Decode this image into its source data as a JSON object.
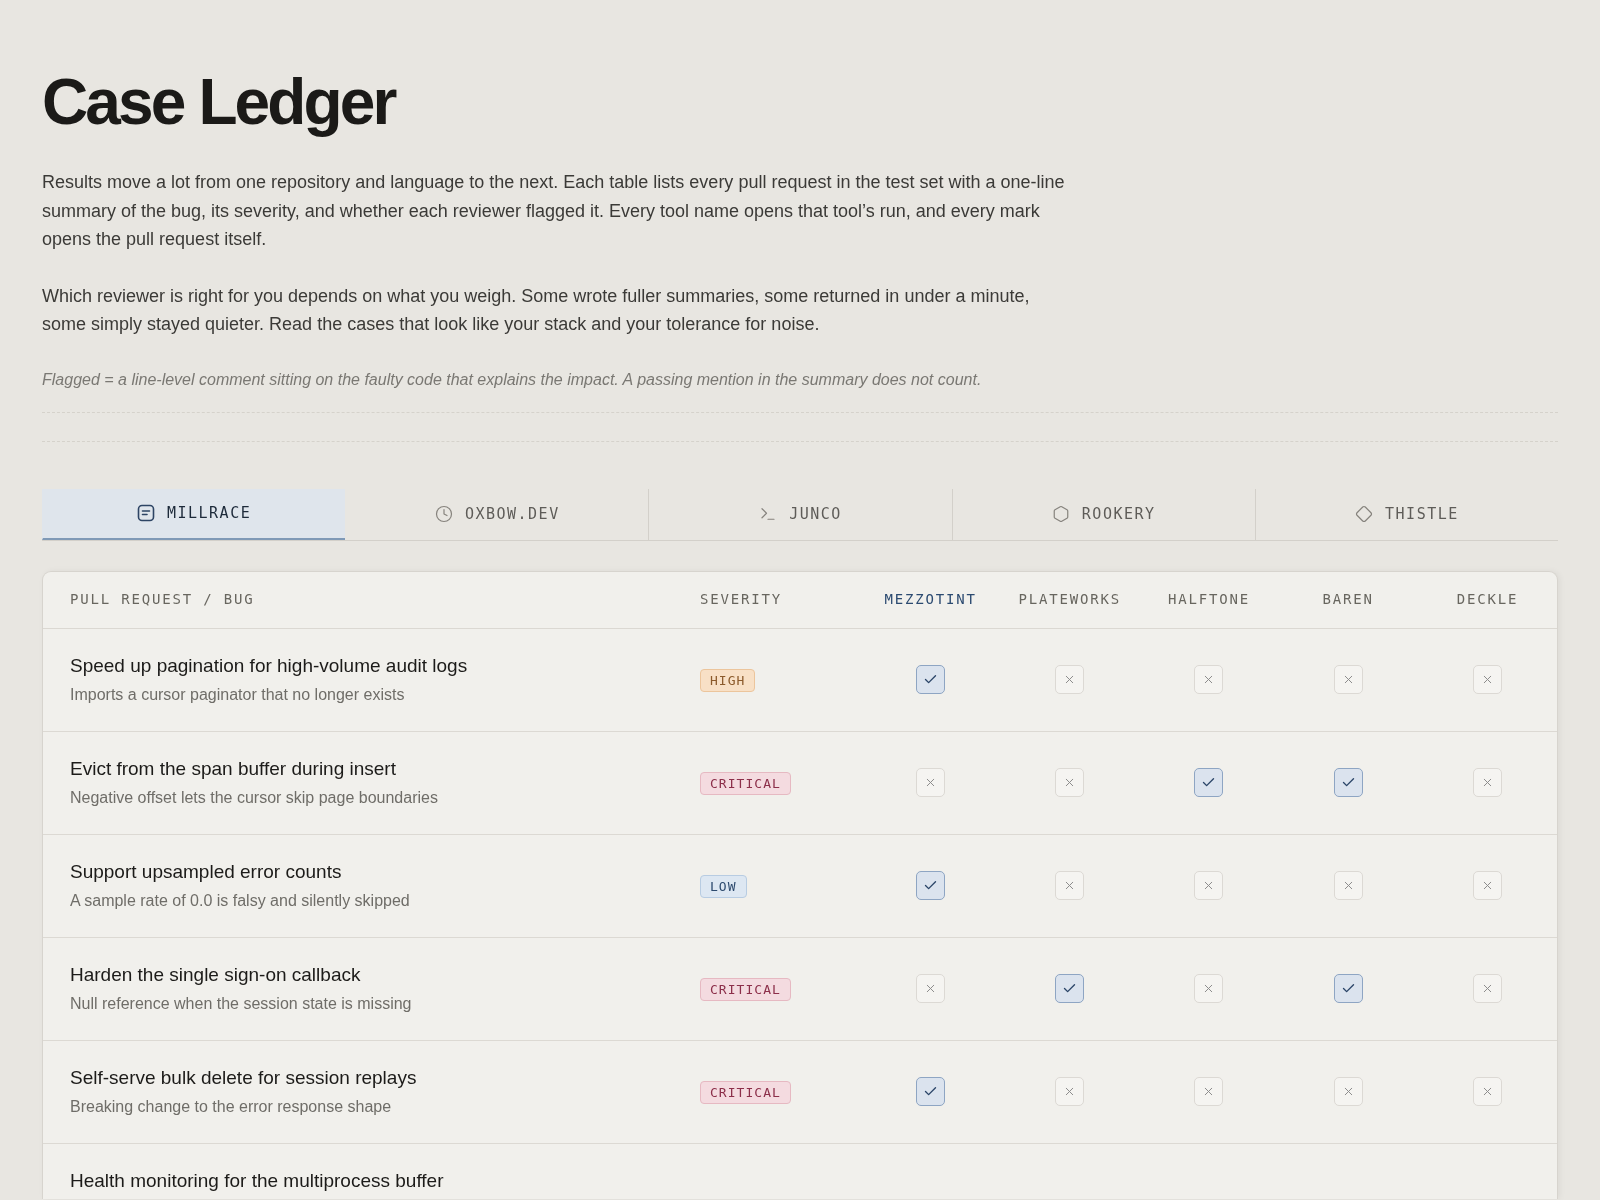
{
  "page": {
    "title": "Case Ledger",
    "paragraphs": [
      "Results move a lot from one repository and language to the next. Each table lists every pull request in the test set with a one-line summary of the bug, its severity, and whether each reviewer flagged it. Every tool name opens that tool’s run, and every mark opens the pull request itself.",
      "Which reviewer is right for you depends on what you weigh. Some wrote fuller summaries, some returned in under a minute, some simply stayed quieter. Read the cases that look like your stack and your tolerance for noise."
    ],
    "note": "Flagged = a line-level comment sitting on the faulty code that explains the impact. A passing mention in the summary does not count."
  },
  "tabs": [
    {
      "label": "MILLRACE",
      "selected": true
    },
    {
      "label": "OXBOW.DEV",
      "selected": false
    },
    {
      "label": "JUNCO",
      "selected": false
    },
    {
      "label": "ROOKERY",
      "selected": false
    },
    {
      "label": "THISTLE",
      "selected": false
    }
  ],
  "table": {
    "columns": [
      "PULL REQUEST / BUG",
      "SEVERITY"
    ],
    "tools": [
      {
        "label": "MEZZOTINT",
        "highlighted": true
      },
      {
        "label": "PLATEWORKS",
        "highlighted": false
      },
      {
        "label": "HALFTONE",
        "highlighted": false
      },
      {
        "label": "BAREN",
        "highlighted": false
      },
      {
        "label": "DECKLE",
        "highlighted": false
      }
    ],
    "rows": [
      {
        "title": "Speed up pagination for high-volume audit logs",
        "summary": "Imports a cursor paginator that no longer exists",
        "severity": {
          "label": "HIGH",
          "kind": "high"
        },
        "marks": [
          {
            "flagged": true
          },
          {
            "flagged": false
          },
          {
            "flagged": false
          },
          {
            "flagged": false
          },
          {
            "flagged": false
          }
        ]
      },
      {
        "title": "Evict from the span buffer during insert",
        "summary": "Negative offset lets the cursor skip page boundaries",
        "severity": {
          "label": "CRITICAL",
          "kind": "critical"
        },
        "marks": [
          {
            "flagged": false
          },
          {
            "flagged": false
          },
          {
            "flagged": true
          },
          {
            "flagged": true
          },
          {
            "flagged": false
          }
        ]
      },
      {
        "title": "Support upsampled error counts",
        "summary": "A sample rate of 0.0 is falsy and silently skipped",
        "severity": {
          "label": "LOW",
          "kind": "low"
        },
        "marks": [
          {
            "flagged": true
          },
          {
            "flagged": false
          },
          {
            "flagged": false
          },
          {
            "flagged": false
          },
          {
            "flagged": false
          }
        ]
      },
      {
        "title": "Harden the single sign-on callback",
        "summary": "Null reference when the session state is missing",
        "severity": {
          "label": "CRITICAL",
          "kind": "critical"
        },
        "marks": [
          {
            "flagged": false
          },
          {
            "flagged": true
          },
          {
            "flagged": false
          },
          {
            "flagged": true
          },
          {
            "flagged": false
          }
        ]
      },
      {
        "title": "Self-serve bulk delete for session replays",
        "summary": "Breaking change to the error response shape",
        "severity": {
          "label": "CRITICAL",
          "kind": "critical"
        },
        "marks": [
          {
            "flagged": true
          },
          {
            "flagged": false
          },
          {
            "flagged": false
          },
          {
            "flagged": false
          },
          {
            "flagged": false
          }
        ]
      },
      {
        "title": "Health monitoring for the multiprocess buffer"
      }
    ]
  }
}
